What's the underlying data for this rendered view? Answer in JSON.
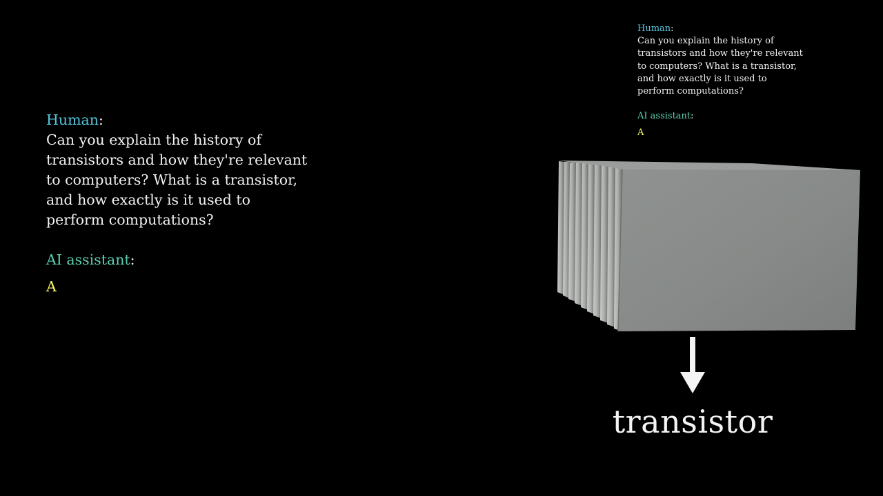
{
  "main_conversation": {
    "human_label": "Human",
    "colon": ":",
    "human_message_lines": [
      "Can you explain the history of",
      "transistors and how they're relevant",
      "to computers? What is a transistor,",
      "and how exactly is it used to",
      "perform computations?"
    ],
    "ai_label": "AI assistant",
    "ai_reply": "A"
  },
  "mini_conversation": {
    "human_label": "Human",
    "colon": ":",
    "human_message_lines": [
      "Can you explain the history of",
      "transistors and how they're relevant",
      "to computers? What is a transistor,",
      "and how exactly is it used to",
      "perform computations?"
    ],
    "ai_label": "AI assistant",
    "ai_reply": "A"
  },
  "caption": "transistor",
  "colors": {
    "background": "#000000",
    "human_label": "#58c4dd",
    "ai_label": "#5cd0b3",
    "predicted_token": "#ffff66",
    "slab_face": "#8a8d8b",
    "arrow": "#f4f4f4"
  }
}
